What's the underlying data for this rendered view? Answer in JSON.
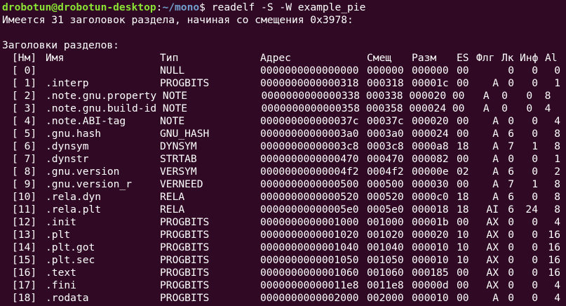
{
  "prompt": {
    "user_host": "drobotun@drobotun-desktop",
    "separator": ":",
    "path": "~/mono",
    "symbol": "$",
    "command": " readelf -S -W example_pie"
  },
  "summary_line": "Имеется 31 заголовок раздела, начиная со смещения 0x3978:",
  "section_title": "Заголовки разделов:",
  "header": {
    "num": "[Нм]",
    "name": "Имя",
    "type": "Тип",
    "addr": "Адрес",
    "off": "Смещ",
    "size": "Разм",
    "es": "ES",
    "flg": "Флг",
    "lk": "Лк",
    "inf": "Инф",
    "al": "Al"
  },
  "rows": [
    {
      "num": "[ 0]",
      "name": "",
      "type": "NULL",
      "addr": "0000000000000000",
      "off": "000000",
      "size": "000000",
      "es": "00",
      "flg": "",
      "lk": "0",
      "inf": "0",
      "al": "0"
    },
    {
      "num": "[ 1]",
      "name": ".interp",
      "type": "PROGBITS",
      "addr": "0000000000000318",
      "off": "000318",
      "size": "00001c",
      "es": "00",
      "flg": "A",
      "lk": "0",
      "inf": "0",
      "al": "1"
    },
    {
      "num": "[ 2]",
      "raw": ".note.gnu.property NOTE            0000000000000338 000338 000020 00   A  0   0  8"
    },
    {
      "num": "[ 3]",
      "raw": ".note.gnu.build-id NOTE            0000000000000358 000358 000024 00   A  0   0  4"
    },
    {
      "num": "[ 4]",
      "name": ".note.ABI-tag",
      "type": "NOTE",
      "addr": "000000000000037c",
      "off": "00037c",
      "size": "000020",
      "es": "00",
      "flg": "A",
      "lk": "0",
      "inf": "0",
      "al": "4"
    },
    {
      "num": "[ 5]",
      "name": ".gnu.hash",
      "type": "GNU_HASH",
      "addr": "00000000000003a0",
      "off": "0003a0",
      "size": "000024",
      "es": "00",
      "flg": "A",
      "lk": "6",
      "inf": "0",
      "al": "8"
    },
    {
      "num": "[ 6]",
      "name": ".dynsym",
      "type": "DYNSYM",
      "addr": "00000000000003c8",
      "off": "0003c8",
      "size": "0000a8",
      "es": "18",
      "flg": "A",
      "lk": "7",
      "inf": "1",
      "al": "8"
    },
    {
      "num": "[ 7]",
      "name": ".dynstr",
      "type": "STRTAB",
      "addr": "0000000000000470",
      "off": "000470",
      "size": "000082",
      "es": "00",
      "flg": "A",
      "lk": "0",
      "inf": "0",
      "al": "1"
    },
    {
      "num": "[ 8]",
      "name": ".gnu.version",
      "type": "VERSYM",
      "addr": "00000000000004f2",
      "off": "0004f2",
      "size": "00000e",
      "es": "02",
      "flg": "A",
      "lk": "6",
      "inf": "0",
      "al": "2"
    },
    {
      "num": "[ 9]",
      "name": ".gnu.version_r",
      "type": "VERNEED",
      "addr": "0000000000000500",
      "off": "000500",
      "size": "000030",
      "es": "00",
      "flg": "A",
      "lk": "7",
      "inf": "1",
      "al": "8"
    },
    {
      "num": "[10]",
      "name": ".rela.dyn",
      "type": "RELA",
      "addr": "0000000000000520",
      "off": "000520",
      "size": "0000c0",
      "es": "18",
      "flg": "A",
      "lk": "6",
      "inf": "0",
      "al": "8"
    },
    {
      "num": "[11]",
      "name": ".rela.plt",
      "type": "RELA",
      "addr": "00000000000005e0",
      "off": "0005e0",
      "size": "000018",
      "es": "18",
      "flg": "AI",
      "lk": "6",
      "inf": "24",
      "al": "8"
    },
    {
      "num": "[12]",
      "name": ".init",
      "type": "PROGBITS",
      "addr": "0000000000001000",
      "off": "001000",
      "size": "00001b",
      "es": "00",
      "flg": "AX",
      "lk": "0",
      "inf": "0",
      "al": "4"
    },
    {
      "num": "[13]",
      "name": ".plt",
      "type": "PROGBITS",
      "addr": "0000000000001020",
      "off": "001020",
      "size": "000020",
      "es": "10",
      "flg": "AX",
      "lk": "0",
      "inf": "0",
      "al": "16"
    },
    {
      "num": "[14]",
      "name": ".plt.got",
      "type": "PROGBITS",
      "addr": "0000000000001040",
      "off": "001040",
      "size": "000010",
      "es": "10",
      "flg": "AX",
      "lk": "0",
      "inf": "0",
      "al": "16"
    },
    {
      "num": "[15]",
      "name": ".plt.sec",
      "type": "PROGBITS",
      "addr": "0000000000001050",
      "off": "001050",
      "size": "000010",
      "es": "10",
      "flg": "AX",
      "lk": "0",
      "inf": "0",
      "al": "16"
    },
    {
      "num": "[16]",
      "name": ".text",
      "type": "PROGBITS",
      "addr": "0000000000001060",
      "off": "001060",
      "size": "000185",
      "es": "00",
      "flg": "AX",
      "lk": "0",
      "inf": "0",
      "al": "16"
    },
    {
      "num": "[17]",
      "name": ".fini",
      "type": "PROGBITS",
      "addr": "00000000000011e8",
      "off": "0011e8",
      "size": "00000d",
      "es": "00",
      "flg": "AX",
      "lk": "0",
      "inf": "0",
      "al": "4"
    },
    {
      "num": "[18]",
      "name": ".rodata",
      "type": "PROGBITS",
      "addr": "0000000000002000",
      "off": "002000",
      "size": "000010",
      "es": "00",
      "flg": "A",
      "lk": "0",
      "inf": "0",
      "al": "4"
    }
  ],
  "colors": {
    "background": "#300a24",
    "text": "#ffffff",
    "prompt_user": "#8ae234",
    "prompt_path": "#729fcf"
  }
}
